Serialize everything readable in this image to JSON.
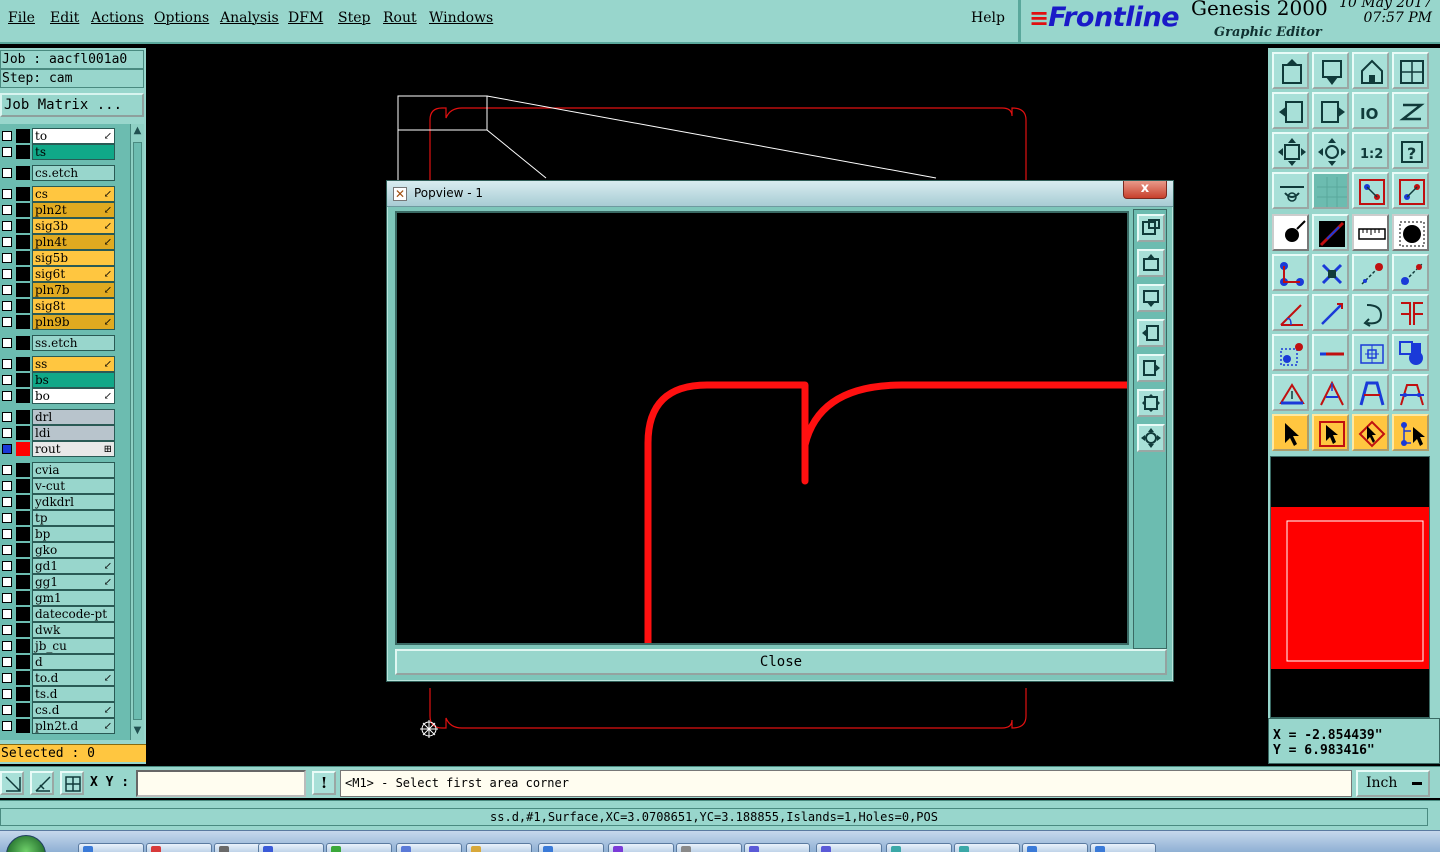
{
  "menubar": {
    "items": [
      {
        "label": "File",
        "id": "file"
      },
      {
        "label": "Edit",
        "id": "edit"
      },
      {
        "label": "Actions",
        "id": "actions"
      },
      {
        "label": "Options",
        "id": "options"
      },
      {
        "label": "Analysis",
        "id": "analysis"
      },
      {
        "label": "DFM",
        "id": "dfm"
      },
      {
        "label": "Step",
        "id": "step"
      },
      {
        "label": "Rout",
        "id": "rout"
      },
      {
        "label": "Windows",
        "id": "windows"
      }
    ],
    "help": "Help"
  },
  "brand": {
    "logo_text": "Frontline",
    "product": "Genesis 2000",
    "subtitle": "Graphic Editor",
    "date": "10 May 2017",
    "time": "07:57 PM"
  },
  "job": {
    "job_line": "Job : aacfl001a0",
    "step_line": "Step: cam",
    "matrix_button": "Job Matrix ..."
  },
  "layers": [
    {
      "name": "to",
      "color": "#ffffff",
      "swatch": "#000000",
      "mark": true,
      "checked": false
    },
    {
      "name": "ts",
      "color": "#10a888",
      "swatch": "#000000",
      "mark": false,
      "checked": false
    },
    {
      "name": "cs.etch",
      "color": "#98d6cc",
      "swatch": "#000000",
      "mark": false,
      "checked": false
    },
    {
      "name": "cs",
      "color": "#ffc640",
      "swatch": "#000000",
      "mark": true,
      "checked": false
    },
    {
      "name": "pln2t",
      "color": "#e0aa20",
      "swatch": "#000000",
      "mark": true,
      "checked": false
    },
    {
      "name": "sig3b",
      "color": "#ffc640",
      "swatch": "#000000",
      "mark": true,
      "checked": false
    },
    {
      "name": "pln4t",
      "color": "#e0aa20",
      "swatch": "#000000",
      "mark": true,
      "checked": false
    },
    {
      "name": "sig5b",
      "color": "#ffc640",
      "swatch": "#000000",
      "mark": false,
      "checked": false
    },
    {
      "name": "sig6t",
      "color": "#ffc640",
      "swatch": "#000000",
      "mark": true,
      "checked": false
    },
    {
      "name": "pln7b",
      "color": "#e0aa20",
      "swatch": "#000000",
      "mark": true,
      "checked": false
    },
    {
      "name": "sig8t",
      "color": "#ffc640",
      "swatch": "#000000",
      "mark": false,
      "checked": false
    },
    {
      "name": "pln9b",
      "color": "#e0aa20",
      "swatch": "#000000",
      "mark": true,
      "checked": false
    },
    {
      "name": "ss.etch",
      "color": "#98d6cc",
      "swatch": "#000000",
      "mark": false,
      "checked": false
    },
    {
      "name": "ss",
      "color": "#ffc640",
      "swatch": "#000000",
      "mark": true,
      "checked": false
    },
    {
      "name": "bs",
      "color": "#10a888",
      "swatch": "#000000",
      "mark": false,
      "checked": false
    },
    {
      "name": "bo",
      "color": "#ffffff",
      "swatch": "#000000",
      "mark": true,
      "checked": false
    },
    {
      "name": "drl",
      "color": "#b8c4cc",
      "swatch": "#000000",
      "mark": false,
      "checked": false
    },
    {
      "name": "ldi",
      "color": "#b8c4cc",
      "swatch": "#000000",
      "mark": false,
      "checked": false
    },
    {
      "name": "rout",
      "color": "#e8e8e8",
      "swatch": "#ff0000",
      "mark": true,
      "checked": true
    },
    {
      "name": "cvia",
      "color": "#98d6cc",
      "swatch": "#000000",
      "mark": false,
      "checked": false
    },
    {
      "name": "v-cut",
      "color": "#98d6cc",
      "swatch": "#000000",
      "mark": false,
      "checked": false
    },
    {
      "name": "ydkdrl",
      "color": "#98d6cc",
      "swatch": "#000000",
      "mark": false,
      "checked": false
    },
    {
      "name": "tp",
      "color": "#98d6cc",
      "swatch": "#000000",
      "mark": false,
      "checked": false
    },
    {
      "name": "bp",
      "color": "#98d6cc",
      "swatch": "#000000",
      "mark": false,
      "checked": false
    },
    {
      "name": "gko",
      "color": "#98d6cc",
      "swatch": "#000000",
      "mark": false,
      "checked": false
    },
    {
      "name": "gd1",
      "color": "#98d6cc",
      "swatch": "#000000",
      "mark": true,
      "checked": false
    },
    {
      "name": "gg1",
      "color": "#98d6cc",
      "swatch": "#000000",
      "mark": true,
      "checked": false
    },
    {
      "name": "gm1",
      "color": "#98d6cc",
      "swatch": "#000000",
      "mark": false,
      "checked": false
    },
    {
      "name": "datecode-pt",
      "color": "#98d6cc",
      "swatch": "#000000",
      "mark": false,
      "checked": false
    },
    {
      "name": "dwk",
      "color": "#98d6cc",
      "swatch": "#000000",
      "mark": false,
      "checked": false
    },
    {
      "name": "jb_cu",
      "color": "#98d6cc",
      "swatch": "#000000",
      "mark": false,
      "checked": false
    },
    {
      "name": "d",
      "color": "#98d6cc",
      "swatch": "#000000",
      "mark": false,
      "checked": false
    },
    {
      "name": "to.d",
      "color": "#98d6cc",
      "swatch": "#000000",
      "mark": true,
      "checked": false
    },
    {
      "name": "ts.d",
      "color": "#98d6cc",
      "swatch": "#000000",
      "mark": false,
      "checked": false
    },
    {
      "name": "cs.d",
      "color": "#98d6cc",
      "swatch": "#000000",
      "mark": true,
      "checked": false
    },
    {
      "name": "pln2t.d",
      "color": "#98d6cc",
      "swatch": "#000000",
      "mark": true,
      "checked": false
    }
  ],
  "selected": "Selected : 0",
  "popview": {
    "title": "Popview - 1",
    "close_x": "x",
    "close_button": "Close"
  },
  "coords": {
    "x": "X = -2.854439\"",
    "y": "Y = 6.983416\""
  },
  "command": {
    "xy_label": "X Y :",
    "xy_value": "",
    "warn": "!",
    "prompt": "<M1> - Select first area corner",
    "unit": "Inch"
  },
  "status": "ss.d,#1,Surface,XC=3.0708651,YC=3.188855,Islands=1,Holes=0,POS",
  "colors": {
    "ui_teal": "#98d6cc",
    "rout_red": "#ff0000",
    "canvas_bg": "#000000"
  },
  "taskbar": {
    "buttons": 16
  }
}
